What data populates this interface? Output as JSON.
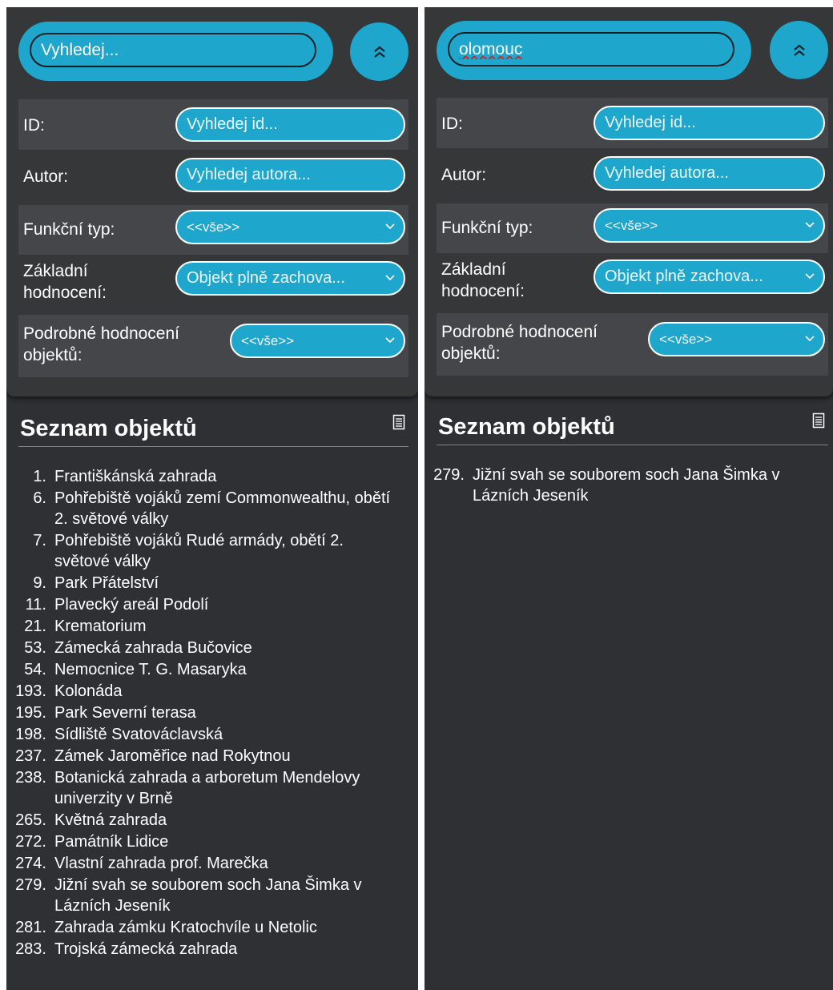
{
  "panels": [
    {
      "search": {
        "value": "",
        "placeholder": "Vyhledej..."
      },
      "filters": {
        "id": {
          "label": "ID:",
          "placeholder": "Vyhledej id..."
        },
        "author": {
          "label": "Autor:",
          "placeholder": "Vyhledej autora..."
        },
        "functional_type": {
          "label": "Funkční typ:",
          "value": "<<vše>>"
        },
        "basic_rating": {
          "label": "Základní hodnocení:",
          "value": "Objekt plně zachova..."
        },
        "detail_rating": {
          "label": "Podrobné hodnocení objektů:",
          "value": "<<vše>>"
        }
      },
      "list": {
        "title": "Seznam objektů",
        "items": [
          {
            "num": "1.",
            "name": "Františkánská zahrada"
          },
          {
            "num": "6.",
            "name": "Pohřebiště vojáků zemí Commonwealthu, obětí 2. světové války"
          },
          {
            "num": "7.",
            "name": "Pohřebiště vojáků Rudé armády, obětí 2. světové války"
          },
          {
            "num": "9.",
            "name": "Park Přátelství"
          },
          {
            "num": "11.",
            "name": "Plavecký areál Podolí"
          },
          {
            "num": "21.",
            "name": "Krematorium"
          },
          {
            "num": "53.",
            "name": "Zámecká zahrada Bučovice"
          },
          {
            "num": "54.",
            "name": "Nemocnice T. G. Masaryka"
          },
          {
            "num": "193.",
            "name": "Kolonáda"
          },
          {
            "num": "195.",
            "name": "Park Severní terasa"
          },
          {
            "num": "198.",
            "name": "Sídliště Svatováclavská"
          },
          {
            "num": "237.",
            "name": "Zámek Jaroměřice nad Rokytnou"
          },
          {
            "num": "238.",
            "name": "Botanická zahrada a arboretum Mendelovy univerzity v Brně"
          },
          {
            "num": "265.",
            "name": "Květná zahrada"
          },
          {
            "num": "272.",
            "name": "Památník Lidice"
          },
          {
            "num": "274.",
            "name": "Vlastní zahrada prof. Marečka"
          },
          {
            "num": "279.",
            "name": "Jižní svah se souborem soch Jana Šimka v Lázních Jeseník"
          },
          {
            "num": "281.",
            "name": "Zahrada zámku Kratochvíle u Netolic"
          },
          {
            "num": "283.",
            "name": "Trojská zámecká zahrada"
          }
        ]
      }
    },
    {
      "search": {
        "value": "olomouc",
        "placeholder": "Vyhledej..."
      },
      "filters": {
        "id": {
          "label": "ID:",
          "placeholder": "Vyhledej id..."
        },
        "author": {
          "label": "Autor:",
          "placeholder": "Vyhledej autora..."
        },
        "functional_type": {
          "label": "Funkční typ:",
          "value": "<<vše>>"
        },
        "basic_rating": {
          "label": "Základní hodnocení:",
          "value": "Objekt plně zachova..."
        },
        "detail_rating": {
          "label": "Podrobné hodnocení objektů:",
          "value": "<<vše>>"
        }
      },
      "list": {
        "title": "Seznam objektů",
        "items": [
          {
            "num": "279.",
            "name": "Jižní svah se souborem soch Jana Šimka v Lázních Jeseník"
          }
        ]
      }
    }
  ],
  "icons": {
    "collapse": "double-chevron-up-icon",
    "dropdown": "chevron-down-icon",
    "list": "document-list-icon"
  },
  "colors": {
    "accent": "#1ea6cc",
    "panel": "#2e3033",
    "filter_box": "#353739",
    "row": "#444649",
    "text": "#ffffff"
  }
}
